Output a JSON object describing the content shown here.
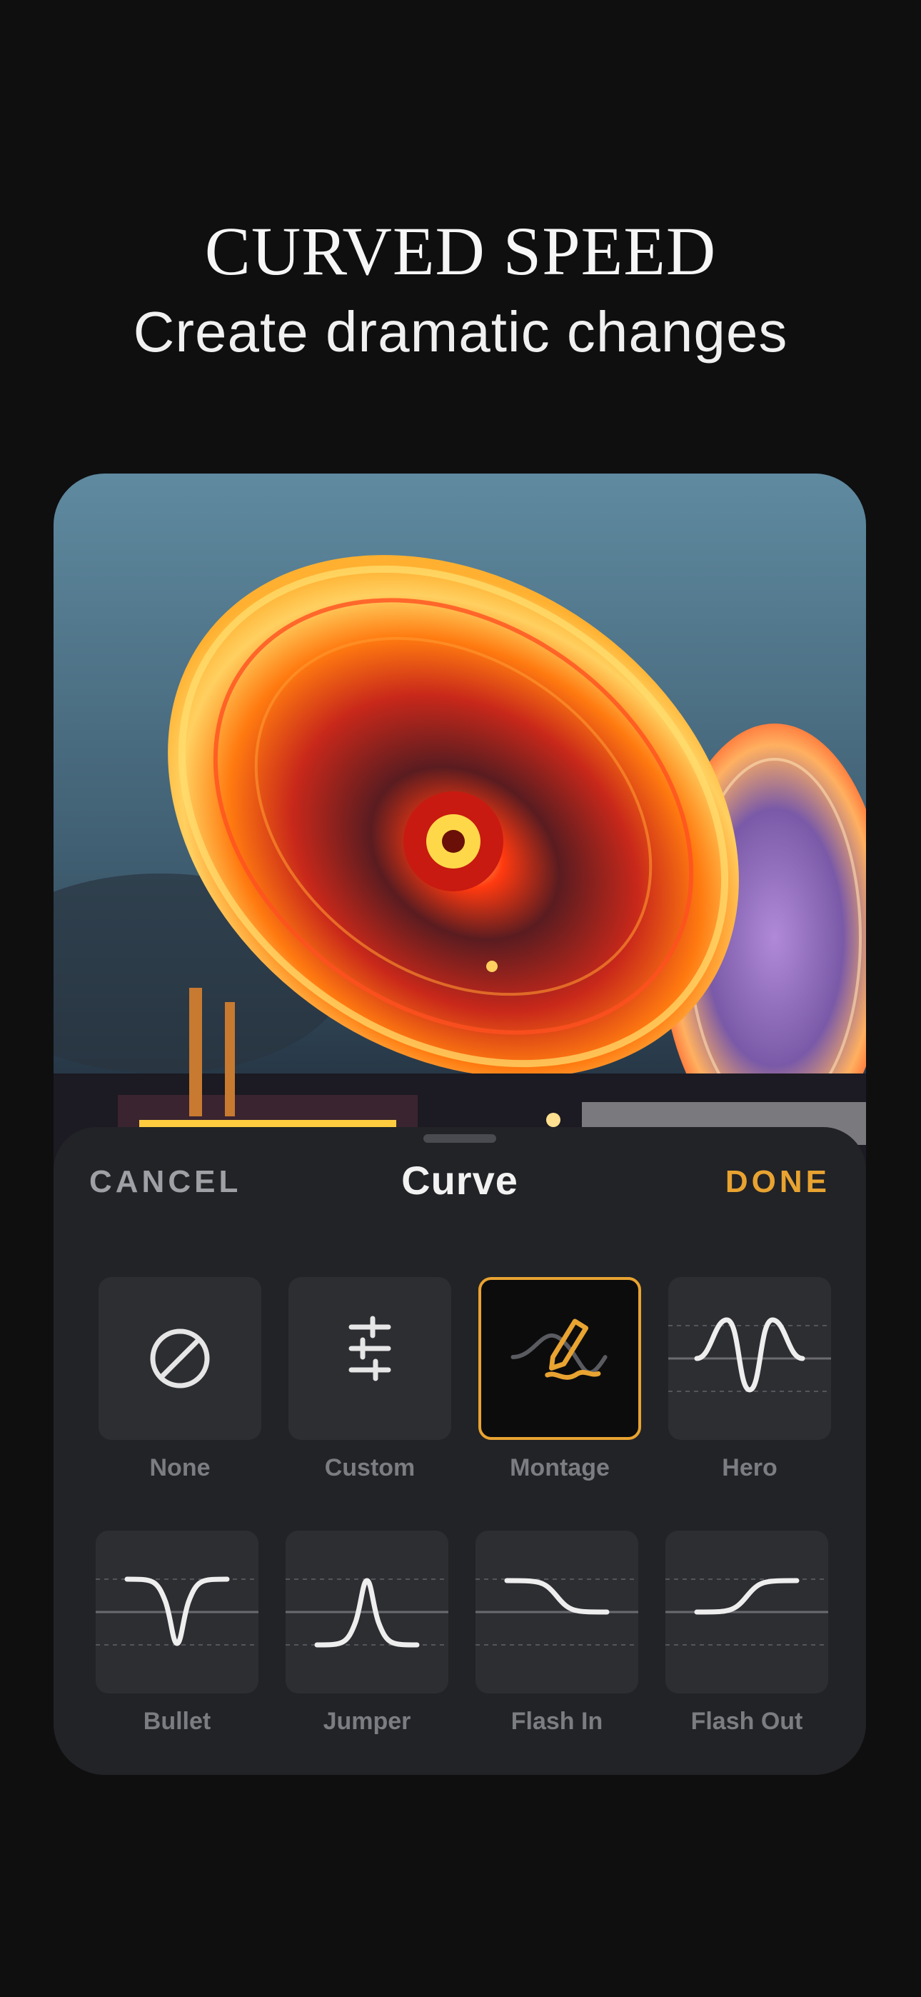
{
  "header": {
    "title": "CURVED SPEED",
    "subtitle": "Create dramatic changes"
  },
  "sheet": {
    "cancel_label": "CANCEL",
    "title": "Curve",
    "done_label": "DONE"
  },
  "presets": [
    {
      "label": "None",
      "icon": "none-icon"
    },
    {
      "label": "Custom",
      "icon": "sliders-icon"
    },
    {
      "label": "Montage",
      "icon": "montage-pen-icon",
      "selected": true
    },
    {
      "label": "Hero",
      "icon": "hero-curve-icon"
    },
    {
      "label": "Bullet",
      "icon": "bullet-curve-icon"
    },
    {
      "label": "Jumper",
      "icon": "jumper-curve-icon"
    },
    {
      "label": "Flash In",
      "icon": "flash-in-curve-icon"
    },
    {
      "label": "Flash Out",
      "icon": "flash-out-curve-icon"
    }
  ],
  "colors": {
    "accent": "#e8a331",
    "background": "#0f0f10",
    "sheet": "#222326",
    "tile": "#2d2e32"
  }
}
